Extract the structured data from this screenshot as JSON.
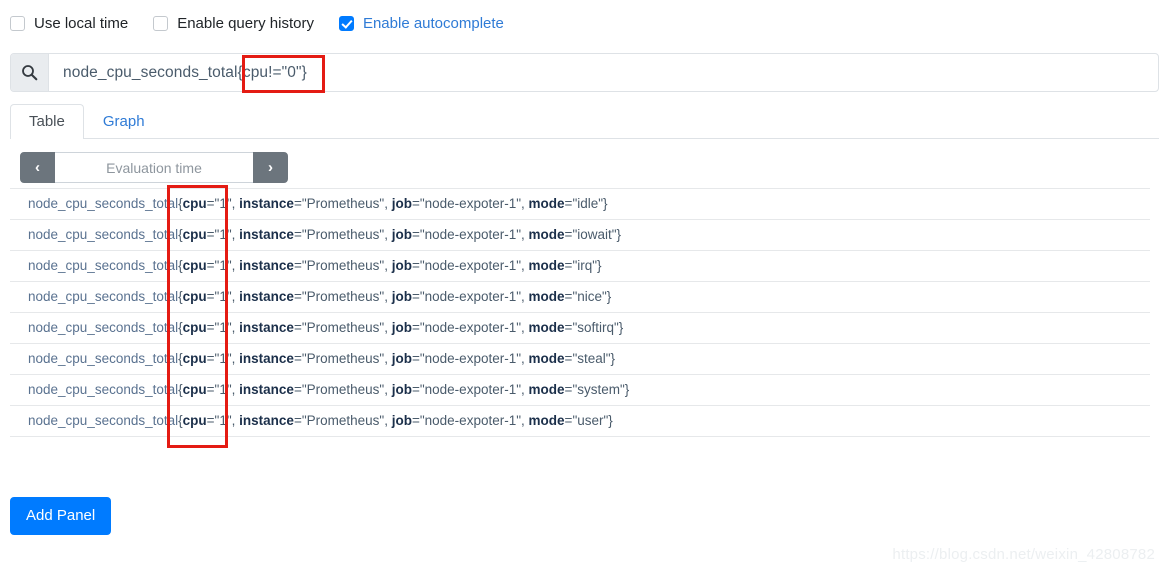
{
  "options": [
    {
      "label": "Use local time",
      "checked": false,
      "name": "use-local-time"
    },
    {
      "label": "Enable query history",
      "checked": false,
      "name": "enable-query-history"
    },
    {
      "label": "Enable autocomplete",
      "checked": true,
      "name": "enable-autocomplete"
    }
  ],
  "query": {
    "icon": "search-icon",
    "value": "node_cpu_seconds_total{cpu!=\"0\"}",
    "placeholder": "Expression (press Shift+Enter for newlines)"
  },
  "tabs": [
    {
      "label": "Table",
      "active": true
    },
    {
      "label": "Graph",
      "active": false
    }
  ],
  "evaluation": {
    "prev_icon": "chevron-left-icon",
    "next_icon": "chevron-right-icon",
    "placeholder": "Evaluation time",
    "value": ""
  },
  "results": {
    "metric": "node_cpu_seconds_total",
    "labels_order": [
      "cpu",
      "instance",
      "job",
      "mode"
    ],
    "rows": [
      {
        "cpu": "1",
        "instance": "Prometheus",
        "job": "node-expoter-1",
        "mode": "idle"
      },
      {
        "cpu": "1",
        "instance": "Prometheus",
        "job": "node-expoter-1",
        "mode": "iowait"
      },
      {
        "cpu": "1",
        "instance": "Prometheus",
        "job": "node-expoter-1",
        "mode": "irq"
      },
      {
        "cpu": "1",
        "instance": "Prometheus",
        "job": "node-expoter-1",
        "mode": "nice"
      },
      {
        "cpu": "1",
        "instance": "Prometheus",
        "job": "node-expoter-1",
        "mode": "softirq"
      },
      {
        "cpu": "1",
        "instance": "Prometheus",
        "job": "node-expoter-1",
        "mode": "steal"
      },
      {
        "cpu": "1",
        "instance": "Prometheus",
        "job": "node-expoter-1",
        "mode": "system"
      },
      {
        "cpu": "1",
        "instance": "Prometheus",
        "job": "node-expoter-1",
        "mode": "user"
      }
    ]
  },
  "add_panel": {
    "label": "Add Panel"
  },
  "annotations": [
    {
      "name": "query-filter-highlight",
      "color": "#e41b13"
    },
    {
      "name": "cpu-label-column-highlight",
      "color": "#e41b13"
    }
  ],
  "watermark": {
    "text": "https://blog.csdn.net/weixin_42808782"
  },
  "colors": {
    "accent": "#007bff",
    "link": "#2f7bd6",
    "annotation": "#e41b13",
    "button_gray": "#6c757d"
  }
}
